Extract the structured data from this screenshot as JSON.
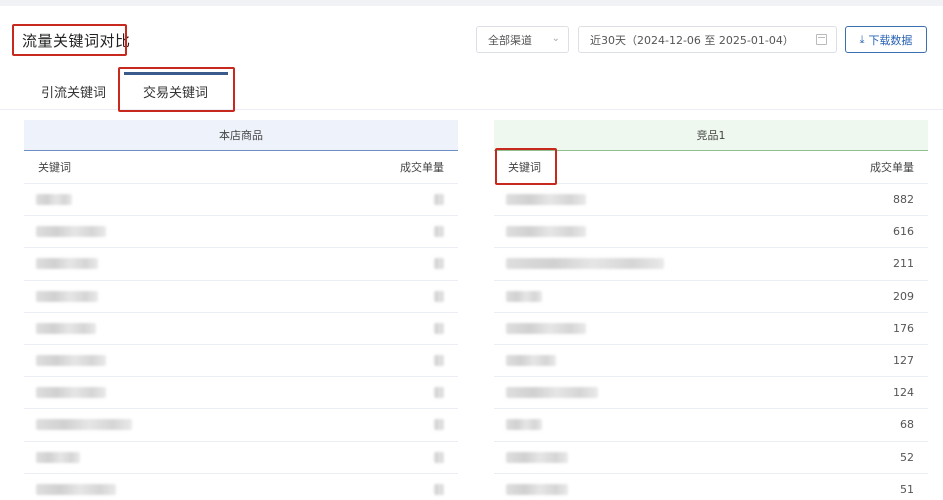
{
  "header": {
    "title": "流量关键词对比",
    "channel": "全部渠道",
    "date_range": "近30天（2024-12-06 至 2025-01-04）",
    "download_label": "下载数据"
  },
  "tabs": [
    {
      "label": "引流关键词",
      "active": false
    },
    {
      "label": "交易关键词",
      "active": true
    }
  ],
  "left_panel": {
    "title": "本店商品",
    "col_keyword": "关键词",
    "col_orders": "成交单量",
    "rows": [
      {
        "kw_len": 36,
        "num": ""
      },
      {
        "kw_len": 70,
        "num": ""
      },
      {
        "kw_len": 62,
        "num": ""
      },
      {
        "kw_len": 62,
        "num": ""
      },
      {
        "kw_len": 60,
        "num": ""
      },
      {
        "kw_len": 70,
        "num": ""
      },
      {
        "kw_len": 70,
        "num": ""
      },
      {
        "kw_len": 96,
        "num": ""
      },
      {
        "kw_len": 44,
        "num": ""
      },
      {
        "kw_len": 80,
        "num": ""
      }
    ]
  },
  "right_panel": {
    "title": "竞品1",
    "col_keyword": "关键词",
    "col_orders": "成交单量",
    "rows": [
      {
        "kw_len": 80,
        "num": "882"
      },
      {
        "kw_len": 80,
        "num": "616"
      },
      {
        "kw_len": 158,
        "num": "211"
      },
      {
        "kw_len": 36,
        "num": "209"
      },
      {
        "kw_len": 80,
        "num": "176"
      },
      {
        "kw_len": 50,
        "num": "127"
      },
      {
        "kw_len": 92,
        "num": "124"
      },
      {
        "kw_len": 36,
        "num": "68"
      },
      {
        "kw_len": 62,
        "num": "52"
      },
      {
        "kw_len": 62,
        "num": "51"
      }
    ]
  },
  "colors": {
    "highlight": "#c8291e",
    "accent": "#2a64b4",
    "left_header_bg": "#eef3fb",
    "right_header_bg": "#eef8ee"
  },
  "icons": {
    "select_arrow": "chevron-down-icon",
    "calendar": "calendar-icon",
    "download": "download-icon"
  }
}
